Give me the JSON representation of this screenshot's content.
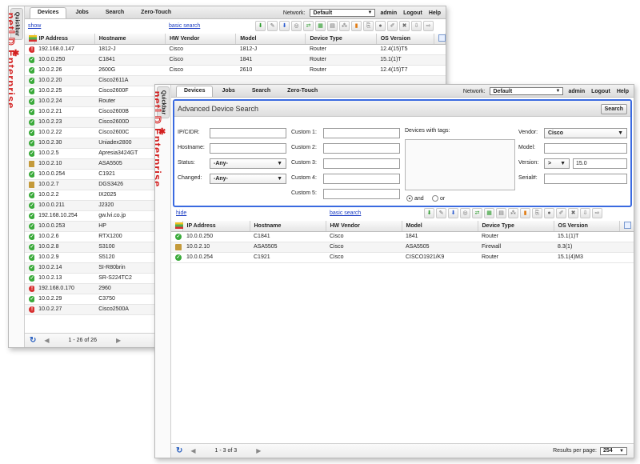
{
  "nav": {
    "tabs": [
      "Devices",
      "Jobs",
      "Search",
      "Zero-Touch"
    ],
    "network_label": "Network:",
    "network_value": "Default",
    "user": "admin",
    "logout": "Logout",
    "help": "Help"
  },
  "quickbar": {
    "label": "Quickbar",
    "brand_prefix": "net",
    "brand_o": "LD",
    "brand_suffix": " Enterprise"
  },
  "back": {
    "show_link": "show",
    "basic_search_link": "basic search",
    "columns": [
      "IP Address",
      "Hostname",
      "HW Vendor",
      "Model",
      "Device Type",
      "OS Version"
    ],
    "rows": [
      [
        "err",
        "192.168.0.147",
        "1812-J",
        "Cisco",
        "1812-J",
        "Router",
        "12.4(15)T5"
      ],
      [
        "ok",
        "10.0.0.250",
        "C1841",
        "Cisco",
        "1841",
        "Router",
        "15.1(1)T"
      ],
      [
        "ok",
        "10.0.2.26",
        "2600G",
        "Cisco",
        "2610",
        "Router",
        "12.4(15)T7"
      ],
      [
        "ok",
        "10.0.2.20",
        "Cisco2611A",
        "",
        "",
        "",
        ""
      ],
      [
        "ok",
        "10.0.2.25",
        "Cisco2600F",
        "",
        "",
        "",
        ""
      ],
      [
        "ok",
        "10.0.2.24",
        "Router",
        "",
        "",
        "",
        ""
      ],
      [
        "ok",
        "10.0.2.21",
        "Cisco2600B",
        "",
        "",
        "",
        ""
      ],
      [
        "ok",
        "10.0.2.23",
        "Cisco2600D",
        "",
        "",
        "",
        ""
      ],
      [
        "ok",
        "10.0.2.22",
        "Cisco2600C",
        "",
        "",
        "",
        ""
      ],
      [
        "ok",
        "10.0.2.30",
        "Uniadex2800",
        "",
        "",
        "",
        ""
      ],
      [
        "ok",
        "10.0.2.5",
        "Apresia3424GT",
        "",
        "",
        "",
        ""
      ],
      [
        "warn",
        "10.0.2.10",
        "ASA5505",
        "",
        "",
        "",
        ""
      ],
      [
        "ok",
        "10.0.0.254",
        "C1921",
        "",
        "",
        "",
        ""
      ],
      [
        "warn",
        "10.0.2.7",
        "DGS3426",
        "",
        "",
        "",
        ""
      ],
      [
        "ok",
        "10.0.2.2",
        "IX2025",
        "",
        "",
        "",
        ""
      ],
      [
        "ok",
        "10.0.0.211",
        "J2320",
        "",
        "",
        "",
        ""
      ],
      [
        "ok",
        "192.168.10.254",
        "gw.lvi.co.jp",
        "",
        "",
        "",
        ""
      ],
      [
        "ok",
        "10.0.0.253",
        "HP",
        "",
        "",
        "",
        ""
      ],
      [
        "ok",
        "10.0.2.6",
        "RTX1200",
        "",
        "",
        "",
        ""
      ],
      [
        "ok",
        "10.0.2.8",
        "S3100",
        "",
        "",
        "",
        ""
      ],
      [
        "ok",
        "10.0.2.9",
        "S5120",
        "",
        "",
        "",
        ""
      ],
      [
        "ok",
        "10.0.2.14",
        "SI-R80brin",
        "",
        "",
        "",
        ""
      ],
      [
        "ok",
        "10.0.2.13",
        "SR-S224TC2",
        "",
        "",
        "",
        ""
      ],
      [
        "err",
        "192.168.0.170",
        "2960",
        "",
        "",
        "",
        ""
      ],
      [
        "ok",
        "10.0.2.29",
        "C3750",
        "",
        "",
        "",
        ""
      ],
      [
        "err",
        "10.0.2.27",
        "Cisco2500A",
        "",
        "",
        "",
        ""
      ]
    ],
    "pager_text": "1 - 26 of 26"
  },
  "adv": {
    "title": "Advanced Device Search",
    "search_button": "Search",
    "ip_label": "IP/CIDR:",
    "hostname_label": "Hostname:",
    "status_label": "Status:",
    "status_value": "-Any-",
    "changed_label": "Changed:",
    "changed_value": "-Any-",
    "custom_labels": [
      "Custom 1:",
      "Custom 2:",
      "Custom 3:",
      "Custom 4:",
      "Custom 5:"
    ],
    "tags_label": "Devices with tags:",
    "and_label": "and",
    "or_label": "or",
    "vendor_label": "Vendor:",
    "vendor_value": "Cisco",
    "model_label": "Model:",
    "version_label": "Version:",
    "version_op": ">",
    "version_value": "15.0",
    "serial_label": "Serial#:"
  },
  "front": {
    "hide_link": "hide",
    "basic_search_link": "basic search",
    "columns": [
      "IP Address",
      "Hostname",
      "HW Vendor",
      "Model",
      "Device Type",
      "OS Version"
    ],
    "rows": [
      [
        "ok",
        "10.0.0.250",
        "C1841",
        "Cisco",
        "1841",
        "Router",
        "15.1(1)T"
      ],
      [
        "warn",
        "10.0.2.10",
        "ASA5505",
        "Cisco",
        "ASA5505",
        "Firewall",
        "8.3(1)"
      ],
      [
        "ok",
        "10.0.0.254",
        "C1921",
        "Cisco",
        "CISCO1921/K9",
        "Router",
        "15.1(4)M3"
      ]
    ],
    "pager_text": "1 - 3 of 3",
    "rpp_label": "Results per page:",
    "rpp_value": "254"
  }
}
